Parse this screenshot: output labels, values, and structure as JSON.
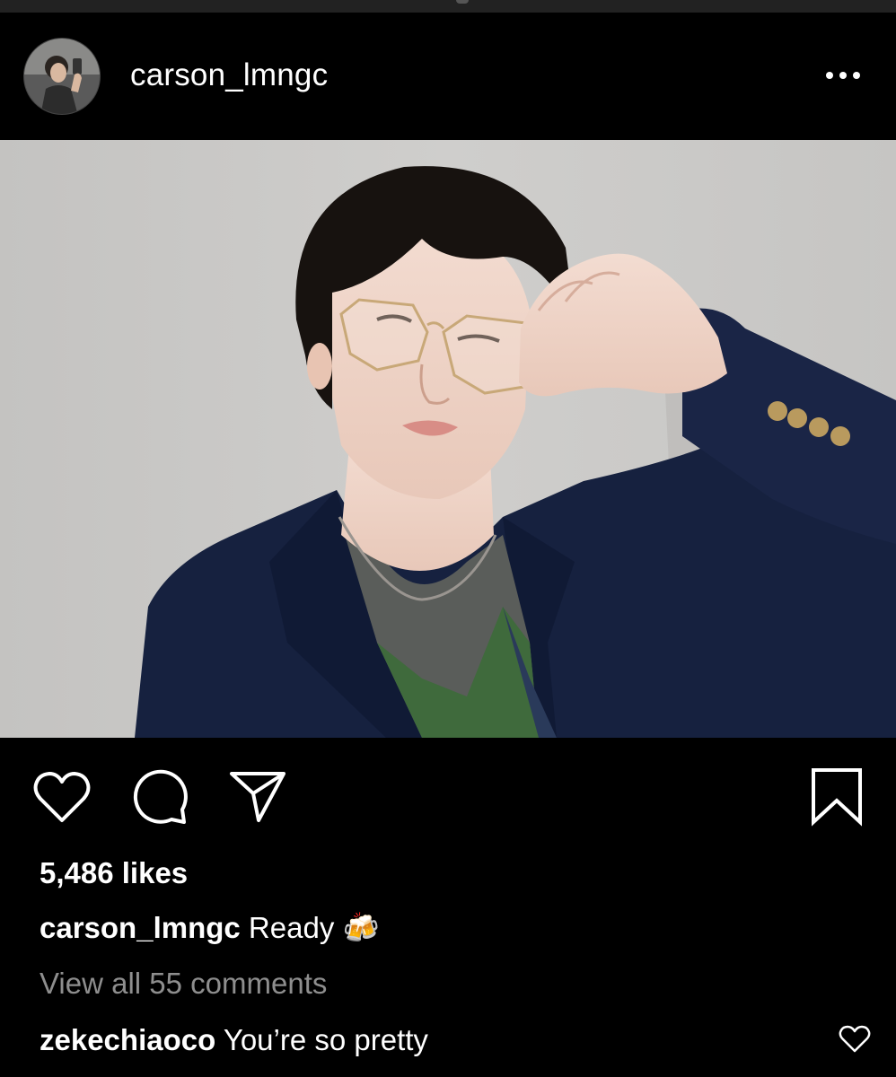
{
  "post": {
    "username": "carson_lmngc",
    "likes_text": "5,486 likes",
    "caption_user": "carson_lmngc",
    "caption_text": "Ready 🍻",
    "view_comments_text": "View all 55 comments"
  },
  "top_comment": {
    "user": "zekechiaoco",
    "text": "You’re so pretty"
  },
  "icons": {
    "more": "more-options-icon",
    "like": "heart-icon",
    "comment": "comment-icon",
    "share": "paper-plane-icon",
    "save": "bookmark-icon",
    "comment_like": "small-heart-icon"
  },
  "colors": {
    "background": "#000000",
    "text": "#ffffff",
    "muted_text": "#8e8e8e"
  }
}
